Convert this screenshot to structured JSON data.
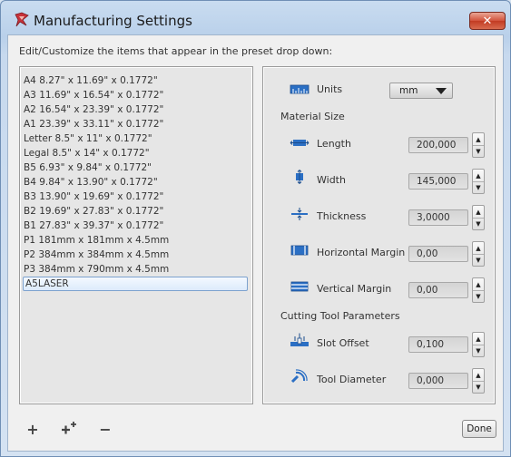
{
  "window": {
    "title": "Manufacturing Settings",
    "close_symbol": "✕"
  },
  "instructions": "Edit/Customize the items that appear in the preset drop down:",
  "presets": [
    "A4 8.27\" x 11.69\" x 0.1772\"",
    "A3 11.69\" x 16.54\" x 0.1772\"",
    "A2 16.54\" x 23.39\" x 0.1772\"",
    "A1 23.39\" x 33.11\" x 0.1772\"",
    "Letter 8.5\" x 11\" x 0.1772\"",
    "Legal 8.5\" x 14\" x 0.1772\"",
    "B5 6.93\" x 9.84\" x 0.1772\"",
    "B4 9.84\" x 13.90\" x 0.1772\"",
    "B3 13.90\" x 19.69\" x 0.1772\"",
    "B2 19.69\" x 27.83\" x 0.1772\"",
    "B1 27.83\" x 39.37\" x 0.1772\"",
    "P1 181mm x 181mm x 4.5mm",
    "P2 384mm x 384mm x 4.5mm",
    "P3 384mm x 790mm x 4.5mm",
    "A5LASER"
  ],
  "selected_preset_index": 14,
  "settings": {
    "units": {
      "label": "Units",
      "value": "mm"
    },
    "material_size_heading": "Material Size",
    "length": {
      "label": "Length",
      "value": "200,000"
    },
    "width": {
      "label": "Width",
      "value": "145,000"
    },
    "thickness": {
      "label": "Thickness",
      "value": "3,0000"
    },
    "horizontal_margin": {
      "label": "Horizontal Margin",
      "value": "0,00"
    },
    "vertical_margin": {
      "label": "Vertical Margin",
      "value": "0,00"
    },
    "cutting_tool_heading": "Cutting Tool Parameters",
    "slot_offset": {
      "label": "Slot Offset",
      "value": "0,100"
    },
    "tool_diameter": {
      "label": "Tool Diameter",
      "value": "0,000"
    }
  },
  "toolbar": {
    "add_symbol": "+",
    "remove_symbol": "−",
    "done_label": "Done"
  },
  "icons": {
    "app": "laser-cutter-icon",
    "units": "ruler-icon",
    "length": "length-arrows-icon",
    "width": "width-arrows-icon",
    "thickness": "thickness-icon",
    "hmargin": "horizontal-margin-icon",
    "vmargin": "vertical-margin-icon",
    "slot": "slot-offset-icon",
    "tool": "tool-diameter-icon"
  },
  "colors": {
    "accent_blue": "#2b6fc4",
    "close_red": "#c23b22"
  }
}
